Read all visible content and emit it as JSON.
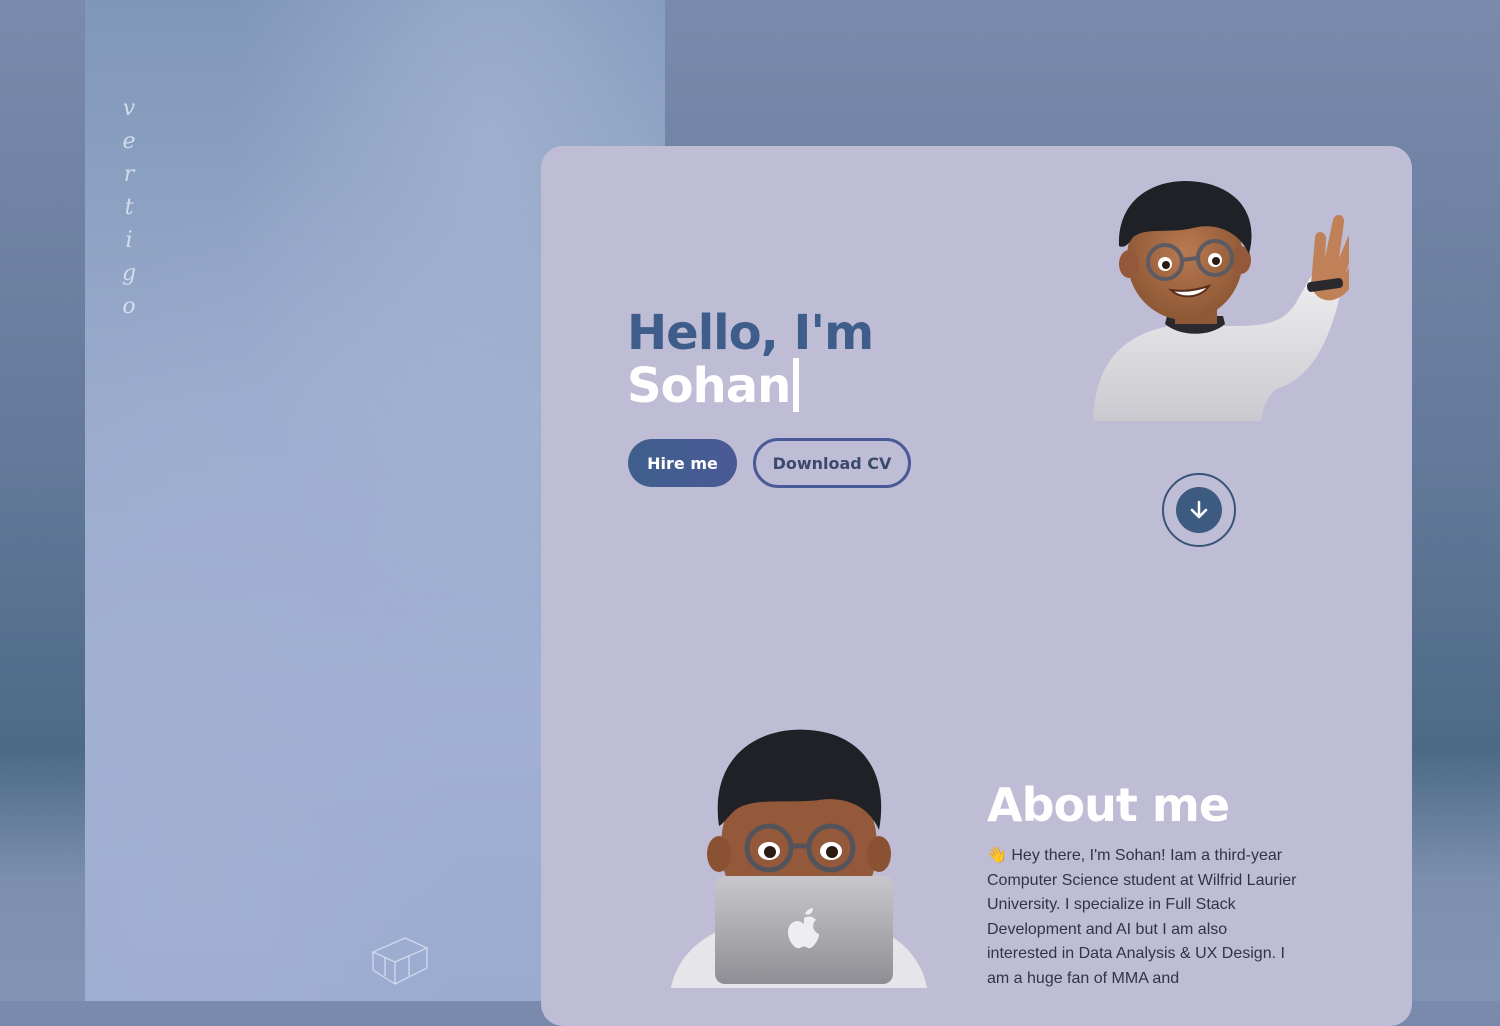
{
  "left_panel": {
    "vertical_text": [
      "v",
      "e",
      "r",
      "t",
      "i",
      "g",
      "o"
    ]
  },
  "hero": {
    "greeting": "Hello, I'm",
    "name": "Sohan"
  },
  "buttons": {
    "hire": "Hire me",
    "download_cv": "Download CV"
  },
  "about": {
    "title": "About me",
    "emoji": "👋",
    "text": "Hey there, I'm Sohan! Iam a third-year Computer Science student at Wilfrid Laurier University. I specialize in Full Stack Development and AI but I am also interested in Data Analysis & UX Design. I am a huge fan of MMA and"
  },
  "colors": {
    "card_bg": "#bfbdd5",
    "accent": "#3f5d8a",
    "button_gradient_end": "#4a5a96"
  },
  "icons": {
    "scroll_button": "arrow-down-icon",
    "avatar_top": "memoji-waving",
    "avatar_bottom": "memoji-laptop",
    "brand": "cube-logo-icon"
  }
}
